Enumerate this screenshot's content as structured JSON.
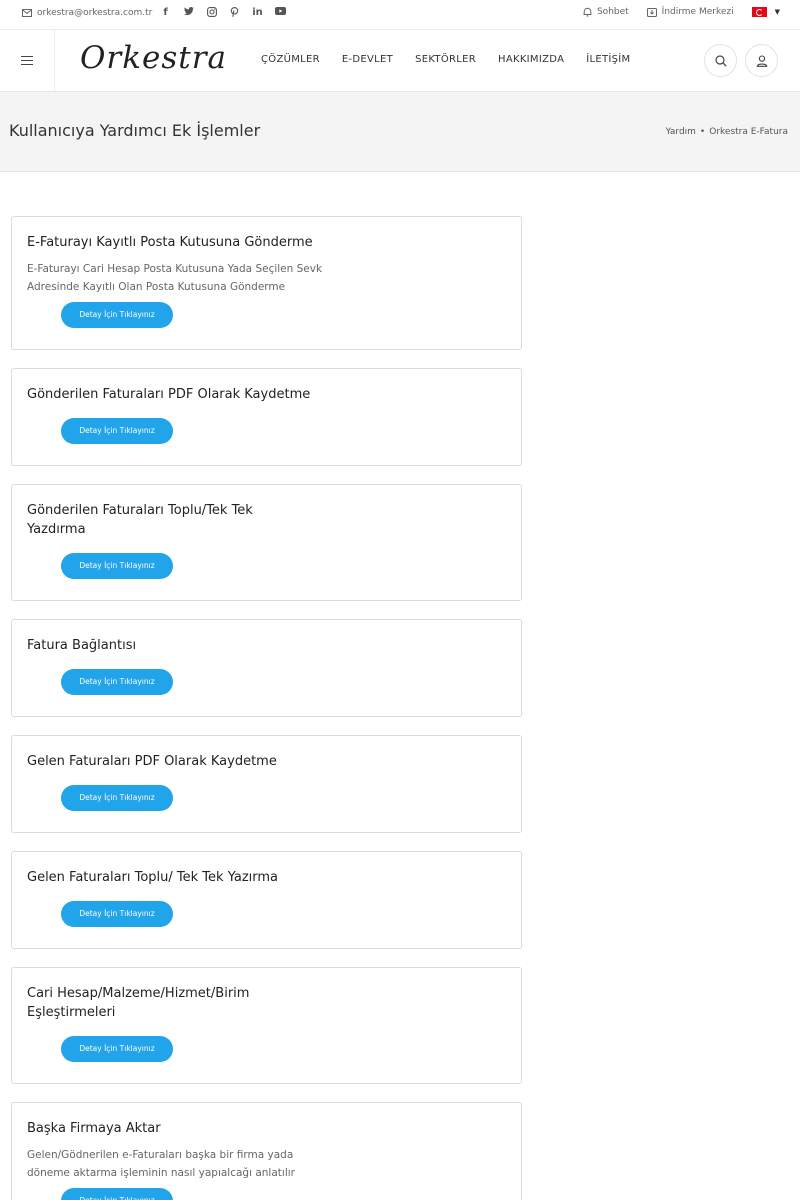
{
  "topbar": {
    "email": "orkestra@orkestra.com.tr",
    "socials": [
      "facebook-icon",
      "twitter-icon",
      "instagram-icon",
      "pinterest-icon",
      "linkedin-icon",
      "youtube-icon"
    ],
    "chat_label": "Sohbet",
    "download_label": "İndirme Merkezi",
    "language": "TR"
  },
  "header": {
    "logo": "Orkestra",
    "nav": [
      "ÇÖZÜMLER",
      "E-DEVLET",
      "SEKTÖRLER",
      "HAKKIMIZDA",
      "İLETİŞİM"
    ]
  },
  "page": {
    "title": "Kullanıcıya Yardımcı Ek İşlemler",
    "breadcrumb": [
      "Yardım",
      "•",
      "Orkestra E-Fatura"
    ]
  },
  "cards": [
    {
      "title": "E-Faturayı Kayıtlı Posta Kutusuna Gönderme",
      "desc": "E-Faturayı Cari Hesap Posta Kutusuna Yada Seçilen Sevk Adresinde Kayıtlı Olan Posta Kutusuna Gönderme",
      "button": "Detay İçin Tıklayınız"
    },
    {
      "title": "Gönderilen Faturaları PDF Olarak Kaydetme",
      "desc": "",
      "button": "Detay İçin Tıklayınız"
    },
    {
      "title": "Gönderilen Faturaları Toplu/Tek Tek Yazdırma",
      "desc": "",
      "button": "Detay İçin Tıklayınız"
    },
    {
      "title": "Fatura Bağlantısı",
      "desc": "",
      "button": "Detay İçin Tıklayınız"
    },
    {
      "title": "Gelen Faturaları PDF Olarak Kaydetme",
      "desc": "",
      "button": "Detay İçin Tıklayınız"
    },
    {
      "title": "Gelen Faturaları Toplu/ Tek Tek Yazırma",
      "desc": "",
      "button": "Detay İçin Tıklayınız"
    },
    {
      "title": "Cari Hesap/Malzeme/Hizmet/Birim Eşleştirmeleri",
      "desc": "",
      "button": "Detay İçin Tıklayınız"
    },
    {
      "title": "Başka Firmaya Aktar",
      "desc": "Gelen/Gödnerilen e-Faturaları başka bir firma yada döneme aktarma işleminin nasıl yapıalcağı anlatılır",
      "button": "Detay İçin Tıklayınız"
    }
  ],
  "colors": {
    "accent": "#22a4ea",
    "band": "#f4f4f4",
    "flag": "#e30a17"
  }
}
